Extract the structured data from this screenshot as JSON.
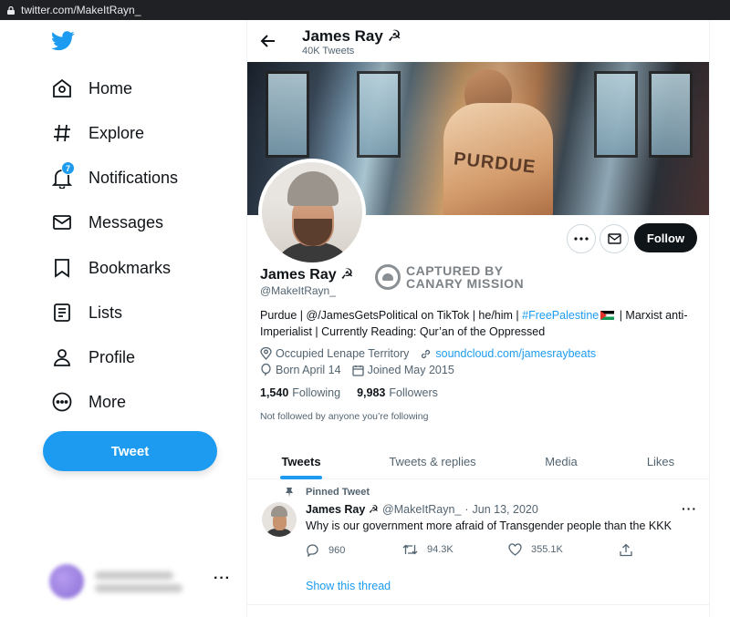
{
  "browser": {
    "url": "twitter.com/MakeItRayn_"
  },
  "nav": {
    "items": [
      {
        "label": "Home",
        "icon": "home-icon"
      },
      {
        "label": "Explore",
        "icon": "hashtag-icon"
      },
      {
        "label": "Notifications",
        "icon": "bell-icon",
        "badge": "7"
      },
      {
        "label": "Messages",
        "icon": "envelope-icon"
      },
      {
        "label": "Bookmarks",
        "icon": "bookmark-icon"
      },
      {
        "label": "Lists",
        "icon": "list-icon"
      },
      {
        "label": "Profile",
        "icon": "person-icon"
      },
      {
        "label": "More",
        "icon": "more-circle-icon"
      }
    ],
    "tweet_button": "Tweet",
    "account_more": "···"
  },
  "header": {
    "name": "James Ray ☭",
    "tweet_count": "40K Tweets"
  },
  "profile": {
    "name": "James Ray ☭",
    "handle": "@MakeItRayn_",
    "follow_label": "Follow",
    "stamp": {
      "line1": "CAPTURED BY",
      "line2": "CANARY MISSION"
    },
    "bio_part1": "Purdue | @/JamesGetsPolitical on TikTok | he/him | ",
    "bio_link": "#FreePalestine",
    "bio_part2": " | Marxist anti-Imperialist | Currently Reading: Qur’an of the Oppressed",
    "location": "Occupied Lenape Territory",
    "website": "soundcloud.com/jamesraybeats",
    "birthday": "Born April 14",
    "joined": "Joined May 2015",
    "following_count": "1,540",
    "following_label": "Following",
    "followers_count": "9,983",
    "followers_label": "Followers",
    "not_followed": "Not followed by anyone you’re following"
  },
  "tabs": [
    "Tweets",
    "Tweets & replies",
    "Media",
    "Likes"
  ],
  "tweet": {
    "pinned_label": "Pinned Tweet",
    "name": "James Ray ☭",
    "handle": "@MakeItRayn_",
    "sep": "·",
    "date": "Jun 13, 2020",
    "text": "Why is our government more afraid of Transgender people than the KKK",
    "replies": "960",
    "retweets": "94.3K",
    "likes": "355.1K",
    "more": "···",
    "show_thread": "Show this thread"
  },
  "colors": {
    "accent": "#1d9bf0",
    "text": "#0f1419",
    "muted": "#536471"
  }
}
